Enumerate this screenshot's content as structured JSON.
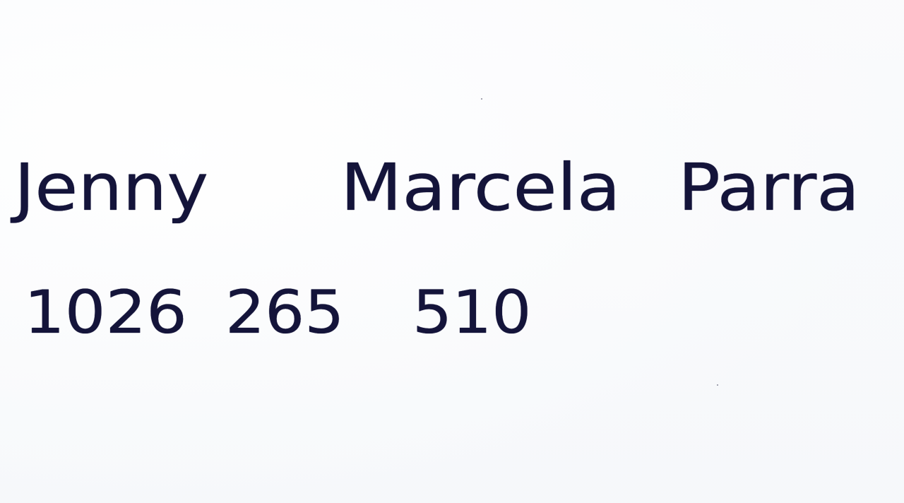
{
  "document": {
    "name_line": {
      "words": [
        "Jenny",
        "Marcela",
        "Parra"
      ]
    },
    "id_line": {
      "groups": [
        "1026",
        "265",
        "510"
      ]
    },
    "ink_color": "#14143a",
    "paper_color": "#fbfcfd"
  }
}
